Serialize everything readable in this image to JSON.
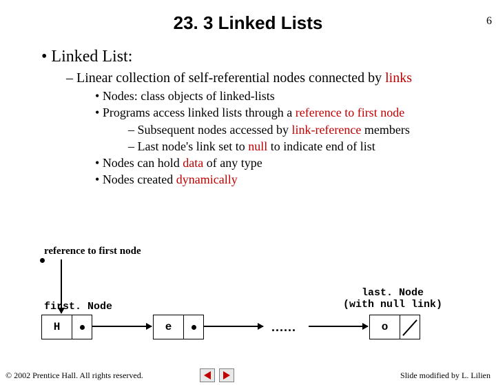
{
  "page_number": "6",
  "title": "23. 3 Linked Lists",
  "bullets": {
    "b1": "Linked List:",
    "b2_pre": "Linear collection of self-referential nodes connected by ",
    "b2_link": "links",
    "b3a": "Nodes: class objects of linked-lists",
    "b3b_pre": "Programs access linked lists through a ",
    "b3b_red": "reference to first node",
    "b4a_pre": "Subsequent nodes accessed by ",
    "b4a_red": "link-reference",
    "b4a_post": " members",
    "b4b_pre": "Last node's link set to ",
    "b4b_red": "null",
    "b4b_post": " to indicate end of list",
    "b3c_pre": "Nodes can hold ",
    "b3c_red": "data",
    "b3c_post": " of any type",
    "b3d_pre": "Nodes created ",
    "b3d_red": "dynamically"
  },
  "diagram": {
    "ref_label": "reference to first node",
    "first_node": "first. Node",
    "last_node_l1": "last. Node",
    "last_node_l2": "(with null link)",
    "n1": "H",
    "n2": "e",
    "n3": "o",
    "ellipsis": "......"
  },
  "footer": {
    "copyright": "© 2002 Prentice Hall. All rights reserved.",
    "credit": "Slide modified by L. Lilien"
  }
}
